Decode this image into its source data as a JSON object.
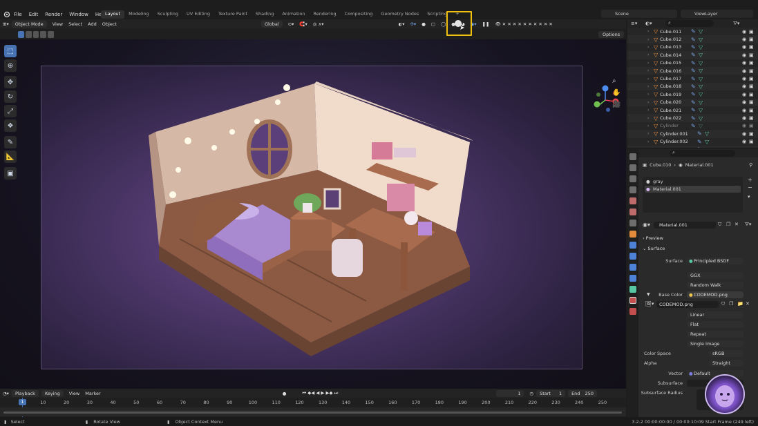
{
  "menu": [
    "File",
    "Edit",
    "Render",
    "Window",
    "Help"
  ],
  "workspaces": [
    "Layout",
    "Modeling",
    "Sculpting",
    "UV Editing",
    "Texture Paint",
    "Shading",
    "Animation",
    "Rendering",
    "Compositing",
    "Geometry Nodes",
    "Scripting"
  ],
  "active_workspace": "Layout",
  "scene": "Scene",
  "view_layer": "ViewLayer",
  "viewport_header": {
    "mode": "Object Mode",
    "view": "View",
    "select": "Select",
    "add": "Add",
    "object": "Object",
    "transform_orientation": "Global",
    "options": "Options"
  },
  "toolbar_icons": [
    "select-box-icon",
    "cursor-icon",
    "move-icon",
    "rotate-icon",
    "scale-icon",
    "transform-icon",
    "annotate-icon",
    "measure-icon",
    "add-cube-icon"
  ],
  "outliner": {
    "rows": [
      {
        "name": "Cube.011",
        "dim": false
      },
      {
        "name": "Cube.012",
        "dim": false
      },
      {
        "name": "Cube.013",
        "dim": false
      },
      {
        "name": "Cube.014",
        "dim": false
      },
      {
        "name": "Cube.015",
        "dim": false
      },
      {
        "name": "Cube.016",
        "dim": false
      },
      {
        "name": "Cube.017",
        "dim": false
      },
      {
        "name": "Cube.018",
        "dim": false
      },
      {
        "name": "Cube.019",
        "dim": false
      },
      {
        "name": "Cube.020",
        "dim": false
      },
      {
        "name": "Cube.021",
        "dim": false
      },
      {
        "name": "Cube.022",
        "dim": false
      },
      {
        "name": "Cylinder",
        "dim": true
      },
      {
        "name": "Cylinder.001",
        "dim": false
      },
      {
        "name": "Cylinder.002",
        "dim": false
      },
      {
        "name": "Cylinder.003",
        "dim": false
      }
    ]
  },
  "properties": {
    "breadcrumb_object": "Cube.010",
    "breadcrumb_material": "Material.001",
    "material_slots": [
      "gray",
      "Material.001"
    ],
    "material_name": "Material.001",
    "preview_label": "Preview",
    "surface_label": "Surface",
    "surface_field_label": "Surface",
    "surface_shader": "Principled BSDF",
    "distribution": "GGX",
    "subsurface_method": "Random Walk",
    "base_color_label": "Base Color",
    "base_color_texture": "CODEMOD.png",
    "image_name": "CODEMOD.png",
    "interpolation": "Linear",
    "projection": "Flat",
    "extension": "Repeat",
    "source": "Single Image",
    "color_space_label": "Color Space",
    "color_space": "sRGB",
    "alpha_label": "Alpha",
    "alpha_mode": "Straight",
    "vector_label": "Vector",
    "vector_value": "Default",
    "subsurface_label": "Subsurface",
    "subsurface_radius_label": "Subsurface Radius"
  },
  "timeline": {
    "playback": "Playback",
    "keying": "Keying",
    "view": "View",
    "marker": "Marker",
    "current_frame": "1",
    "start_label": "Start",
    "start": "1",
    "end_label": "End",
    "end": "250",
    "ticks": [
      "1",
      "10",
      "20",
      "30",
      "40",
      "50",
      "60",
      "70",
      "80",
      "90",
      "100",
      "110",
      "120",
      "130",
      "140",
      "150",
      "160",
      "170",
      "180",
      "190",
      "200",
      "210",
      "220",
      "230",
      "240",
      "250"
    ]
  },
  "statusbar": {
    "select": "Select",
    "rotate": "Rotate View",
    "context": "Object Context Menu",
    "info": "3.2.2  00:00:00:00 / 00:00:10:09  Start Frame (249 left)"
  },
  "colors": {
    "accent": "#4772b3",
    "highlight": "#f2c10f",
    "mesh_orange": "#f29545",
    "mesh_green": "#58c6a3"
  }
}
